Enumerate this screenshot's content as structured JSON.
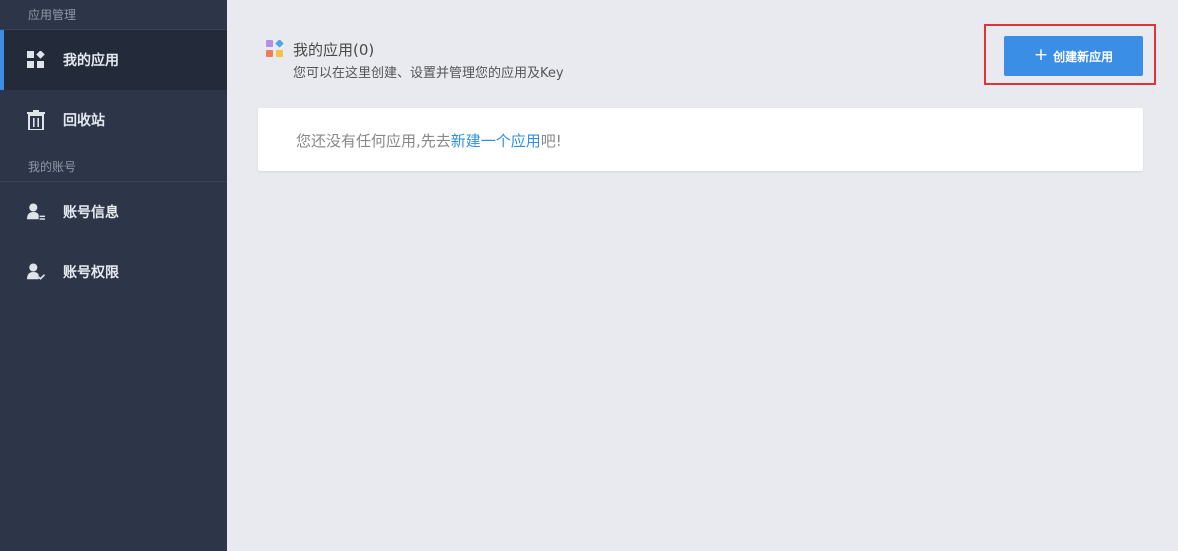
{
  "sidebar": {
    "section_app": "应用管理",
    "section_account": "我的账号",
    "items": [
      {
        "label": "我的应用",
        "icon": "grid-icon",
        "active": true
      },
      {
        "label": "回收站",
        "icon": "trash-icon",
        "active": false
      },
      {
        "label": "账号信息",
        "icon": "user-info-icon",
        "active": false
      },
      {
        "label": "账号权限",
        "icon": "user-check-icon",
        "active": false
      }
    ]
  },
  "header": {
    "title": "我的应用(0)",
    "subtitle": "您可以在这里创建、设置并管理您的应用及Key",
    "create_button": "创建新应用",
    "create_icon": "plus-icon"
  },
  "empty_state": {
    "prefix": "您还没有任何应用,先去",
    "link": "新建一个应用",
    "suffix": "吧!"
  },
  "colors": {
    "sidebar_bg": "#2d3648",
    "sidebar_active_bg": "#232b3a",
    "accent": "#3a8ee6",
    "highlight": "#e0343a",
    "main_bg": "#e9eaef"
  }
}
